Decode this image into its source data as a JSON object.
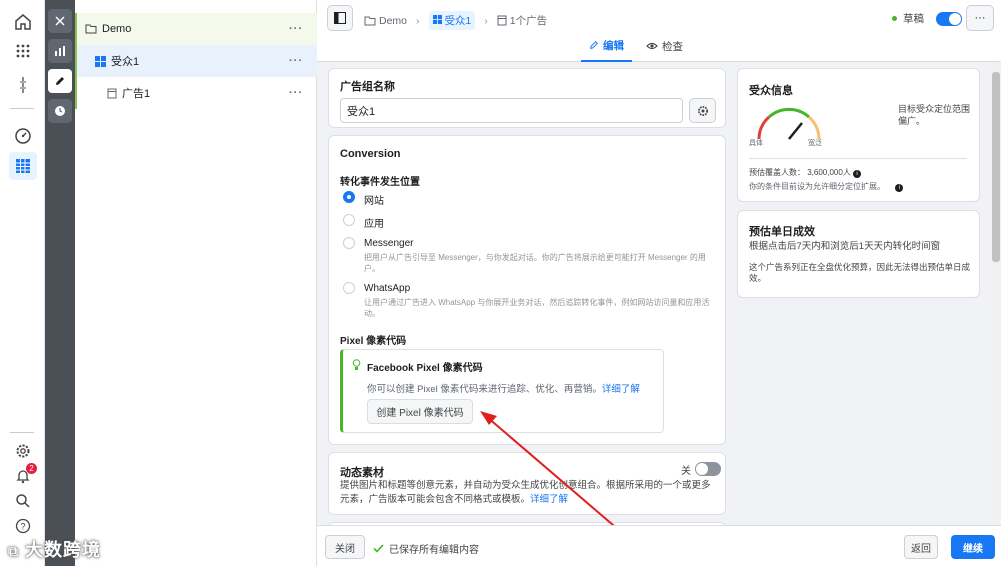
{
  "rail": {
    "notification_count": "2"
  },
  "tree": {
    "campaign": "Demo",
    "adset": "受众1",
    "ad": "广告1",
    "more": "···"
  },
  "header": {
    "crumbs": [
      "Demo",
      "受众1",
      "1个广告"
    ],
    "tabs": [
      "编辑",
      "检查"
    ],
    "status": "草稿",
    "more": "···"
  },
  "adset_name": {
    "label": "广告组名称",
    "value": "受众1"
  },
  "conversion": {
    "title": "Conversion",
    "location_label": "转化事件发生位置",
    "options": [
      {
        "label": "网站",
        "desc": ""
      },
      {
        "label": "应用",
        "desc": ""
      },
      {
        "label": "Messenger",
        "desc": "把用户从广告引导至 Messenger，与你发起对话。你的广告将展示给更可能打开 Messenger 的用户。"
      },
      {
        "label": "WhatsApp",
        "desc": "让用户通过广告进入 WhatsApp 与你展开业务对话，然后追踪转化事件，例如网站访问量和应用活动。"
      }
    ],
    "pixel_label": "Pixel 像素代码",
    "pixel_box_title": "Facebook Pixel 像素代码",
    "pixel_box_text": "你可以创建 Pixel 像素代码来进行追踪、优化、再营销。",
    "pixel_box_link": "详细了解",
    "pixel_button": "创建 Pixel 像素代码"
  },
  "dynamic": {
    "title": "动态素材",
    "toggle_label": "关",
    "desc": "提供图片和标题等创意元素，并自动为受众生成优化创意组合。根据所采用的一个或更多元素，广告版本可能会包含不同格式或模板。",
    "link": "详细了解"
  },
  "audience": {
    "title": "受众信息",
    "gauge_low": "具体",
    "gauge_high": "宽泛",
    "summary": "目标受众定位范围偏广。",
    "reach_label": "预估覆盖人数：",
    "reach_value": "3,600,000人",
    "reach_note": "你的条件目前设为允许细分定位扩展。"
  },
  "daily": {
    "title": "预估单日成效",
    "subtitle": "根据点击后7天内和浏览后1天天内转化时间窗",
    "note": "这个广告系列正在全盘优化预算，因此无法得出预估单日成效。"
  },
  "footer": {
    "close": "关闭",
    "saved": "已保存所有编辑内容",
    "back": "返回",
    "continue": "继续"
  },
  "watermark": "大数跨境"
}
